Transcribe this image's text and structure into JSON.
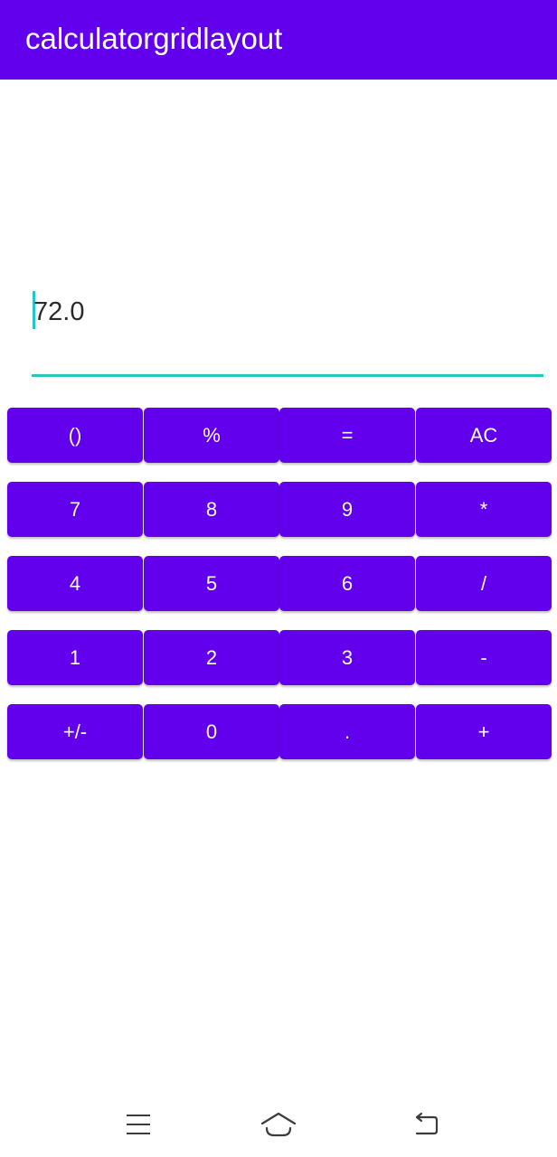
{
  "app_bar": {
    "title": "calculatorgridlayout",
    "color": "#6200EE"
  },
  "display": {
    "value": "72.0",
    "accent_color": "#26C6C6"
  },
  "keypad": {
    "button_color": "#6200EE",
    "rows": [
      [
        "()",
        "%",
        "=",
        "AC"
      ],
      [
        "7",
        "8",
        "9",
        "*"
      ],
      [
        "4",
        "5",
        "6",
        "/"
      ],
      [
        "1",
        "2",
        "3",
        "-"
      ],
      [
        "+/-",
        "0",
        ".",
        "+"
      ]
    ]
  },
  "nav_bar": {
    "icons": [
      "menu-icon",
      "home-icon",
      "back-icon"
    ]
  }
}
